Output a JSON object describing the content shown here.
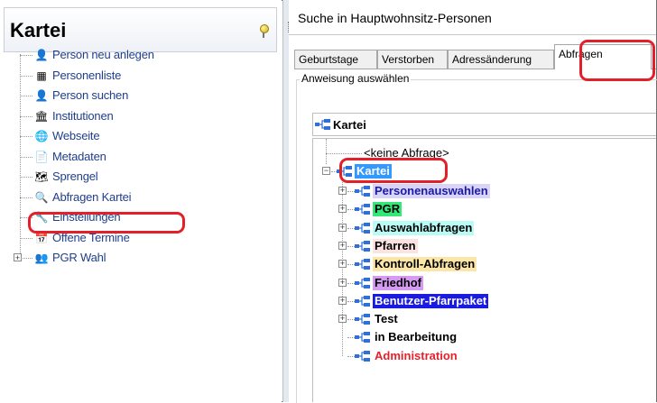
{
  "left": {
    "title": "Kartei",
    "items": [
      {
        "label": "Person neu anlegen",
        "icon": "person-add-icon",
        "glyph": "👤"
      },
      {
        "label": "Personenliste",
        "icon": "list-icon",
        "glyph": "▦"
      },
      {
        "label": "Person suchen",
        "icon": "person-search-icon",
        "glyph": "👤"
      },
      {
        "label": "Institutionen",
        "icon": "institution-icon",
        "glyph": "🏛"
      },
      {
        "label": "Webseite",
        "icon": "globe-icon",
        "glyph": "🌐"
      },
      {
        "label": "Metadaten",
        "icon": "metadata-icon",
        "glyph": "📄"
      },
      {
        "label": "Sprengel",
        "icon": "map-icon",
        "glyph": "🗺"
      },
      {
        "label": "Abfragen Kartei",
        "icon": "magnifier-icon",
        "glyph": "🔍"
      },
      {
        "label": "Einstellungen",
        "icon": "settings-icon",
        "glyph": "🔧"
      },
      {
        "label": "Offene Termine",
        "icon": "calendar-icon",
        "glyph": "📅"
      },
      {
        "label": "PGR Wahl",
        "icon": "people-icon",
        "glyph": "👥",
        "expandable": true
      }
    ]
  },
  "right": {
    "title": "Suche in Hauptwohnsitz-Personen",
    "tabs": [
      "Geburtstage",
      "Verstorben",
      "Adressänderung",
      "Abfragen"
    ],
    "active_tab": "Abfragen",
    "group_label": "Anweisung auswählen",
    "combo_value": "Kartei",
    "tree": {
      "none_option": "<keine Abfrage>",
      "root": "Kartei",
      "children": [
        {
          "label": "Personenauswahlen",
          "bg": "#d8d4f6",
          "fg": "#1a1aa8",
          "expandable": true
        },
        {
          "label": "PGR",
          "bg": "#34e877",
          "fg": "#000000",
          "expandable": true
        },
        {
          "label": "Auswahlabfragen",
          "bg": "#b9fbf5",
          "fg": "#000000",
          "expandable": true
        },
        {
          "label": "Pfarren",
          "bg": "#fde2e2",
          "fg": "#000000",
          "expandable": true
        },
        {
          "label": "Kontroll-Abfragen",
          "bg": "#fbe6a8",
          "fg": "#000000",
          "expandable": true
        },
        {
          "label": "Friedhof",
          "bg": "#d59af2",
          "fg": "#000000",
          "expandable": true
        },
        {
          "label": "Benutzer-Pfarrpaket",
          "bg": "#1a1ae0",
          "fg": "#ffffff",
          "expandable": true
        },
        {
          "label": "Test",
          "bg": "transparent",
          "fg": "#000000",
          "expandable": true
        },
        {
          "label": "in Bearbeitung",
          "bg": "transparent",
          "fg": "#000000",
          "expandable": false
        },
        {
          "label": "Administration",
          "bg": "transparent",
          "fg": "#e8202a",
          "expandable": false
        }
      ]
    }
  },
  "colors": {
    "highlight": "#e3202a",
    "link": "#1f3e8d",
    "selection": "#3399ff"
  }
}
